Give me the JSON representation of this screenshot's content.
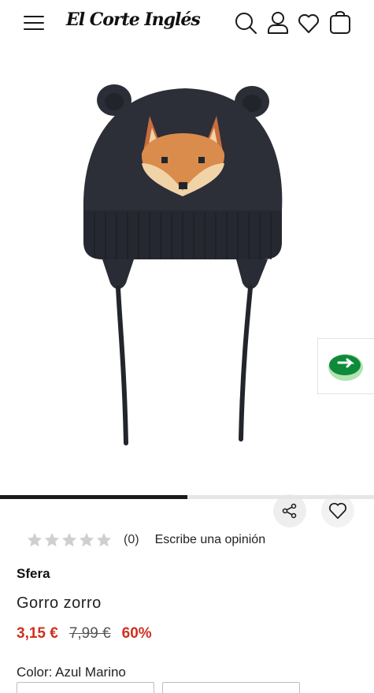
{
  "header": {
    "logo_text": "El Corte Inglés",
    "icons": [
      "menu-icon",
      "search-icon",
      "user-icon",
      "heart-icon",
      "bag-icon"
    ]
  },
  "gallery": {
    "image_alt": "Gorro zorro",
    "progress": 0.5
  },
  "rating": {
    "stars": 0,
    "count": "(0)",
    "write_review": "Escribe una opinión"
  },
  "product": {
    "brand": "Sfera",
    "name": "Gorro zorro",
    "price_current": "3,15 €",
    "price_original": "7,99 €",
    "discount": "60%",
    "color": "Color: Azul Marino"
  },
  "colors": {
    "price_red": "#d0301f",
    "widget_green": "#0f8a3a",
    "hat_navy": "#2b2d37"
  }
}
